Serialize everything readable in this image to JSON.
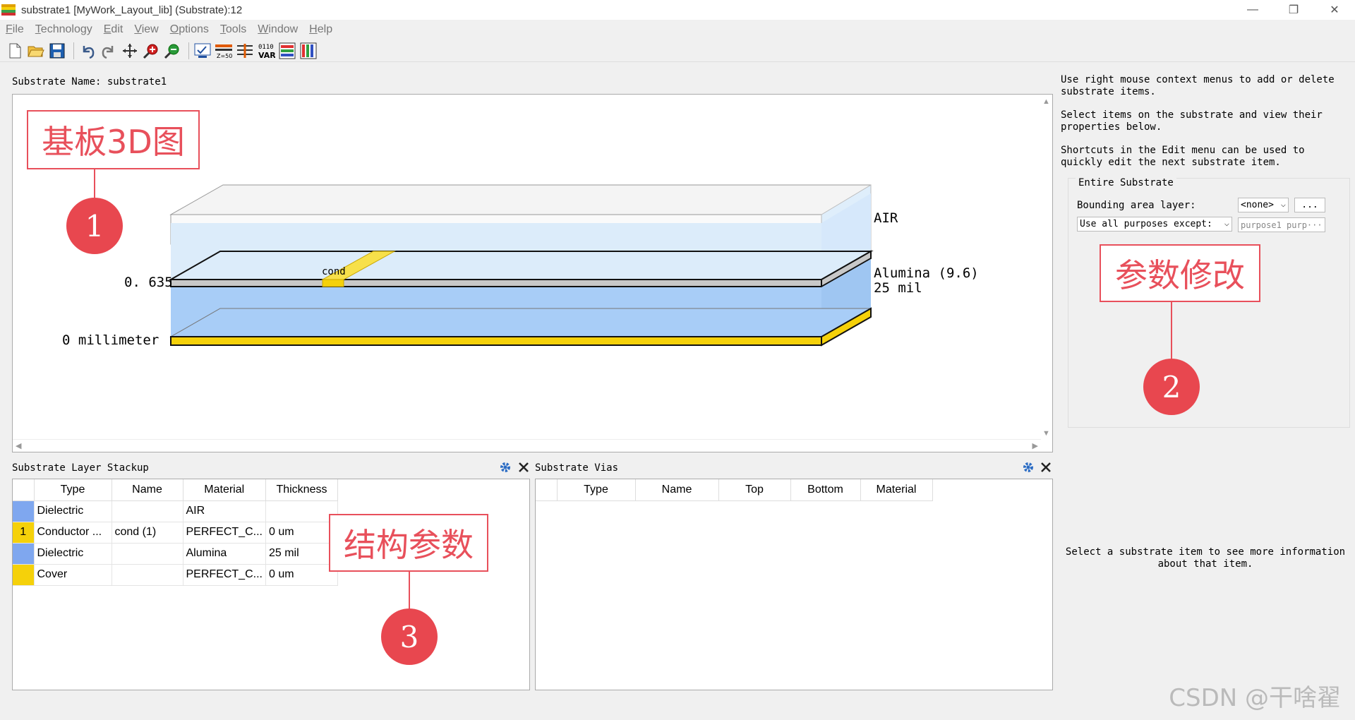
{
  "window": {
    "title": "substrate1 [MyWork_Layout_lib] (Substrate):12",
    "minimize_label": "—",
    "restore_label": "❐",
    "close_label": "✕"
  },
  "menu": [
    "File",
    "Technology",
    "Edit",
    "View",
    "Options",
    "Tools",
    "Window",
    "Help"
  ],
  "toolbar": {
    "icons": [
      "new-file-icon",
      "open-folder-icon",
      "save-icon",
      "undo-icon",
      "redo-icon",
      "pan-icon",
      "zoom-in-icon",
      "zoom-out-icon",
      "check-icon",
      "z50-icon",
      "stackup-icon",
      "var-icon",
      "layers-icon",
      "columns-icon"
    ],
    "z50_label": "Z=50",
    "var_label": "VAR",
    "bin_label": "0110"
  },
  "substrate_name": "Substrate Name:  substrate1",
  "view3d": {
    "air_label": "AIR",
    "material_label": "Alumina  (9.6)",
    "thickness_label": "25 mil",
    "top_value": "0. 635",
    "bottom_value": "0 millimeter",
    "cond_label": "cond"
  },
  "annotations": {
    "a1_text": "基板3D图",
    "a1_num": "1",
    "a2_text": "参数修改",
    "a2_num": "2",
    "a3_text": "结构参数",
    "a3_num": "3"
  },
  "help": {
    "p1": "Use right mouse context menus to add or delete substrate items.",
    "p2": "Select items on the substrate and view their properties below.",
    "p3": "Shortcuts in the Edit menu can be used to quickly edit the next substrate item.",
    "entire_title": "Entire Substrate",
    "bounding_label": "Bounding area layer:",
    "bounding_value": "<none>",
    "ellipsis_label": "...",
    "purposes_label": "Use all purposes except:",
    "purposes_value": "purpose1 purp···"
  },
  "stackup": {
    "title": "Substrate Layer Stackup",
    "columns": [
      "Type",
      "Name",
      "Material",
      "Thickness"
    ],
    "rows": [
      {
        "idx": "",
        "color": "#7fa7ef",
        "type": "Dielectric",
        "name": "",
        "material": "AIR",
        "thickness": ""
      },
      {
        "idx": "1",
        "color": "#f5d10a",
        "type": "Conductor ...",
        "name": "cond (1)",
        "material": "PERFECT_C...",
        "thickness": "0 um"
      },
      {
        "idx": "",
        "color": "#7fa7ef",
        "type": "Dielectric",
        "name": "",
        "material": "Alumina",
        "thickness": "25 mil"
      },
      {
        "idx": "",
        "color": "#f5d10a",
        "type": "Cover",
        "name": "",
        "material": "PERFECT_C...",
        "thickness": "0 um"
      }
    ]
  },
  "vias": {
    "title": "Substrate Vias",
    "columns": [
      "Type",
      "Name",
      "Top",
      "Bottom",
      "Material"
    ],
    "empty_message": "Select a substrate item to see more information about that item."
  },
  "watermark": "CSDN @干啥翟"
}
